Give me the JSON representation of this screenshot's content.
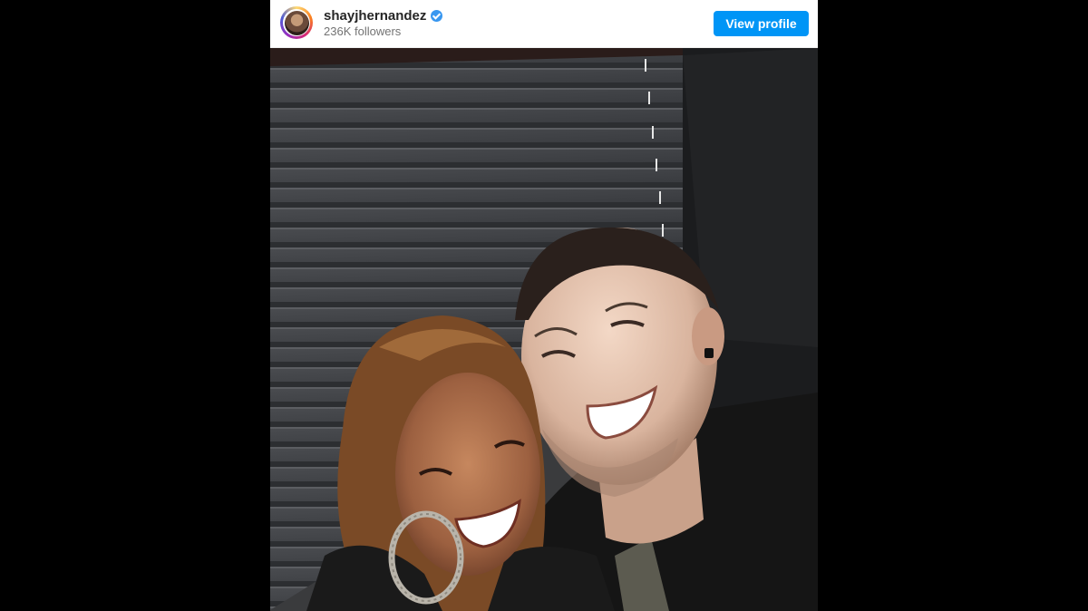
{
  "post": {
    "username": "shayjhernandez",
    "followers": "236K followers",
    "view_profile_label": "View profile",
    "verified": true
  },
  "icons": {
    "verified": "verified-badge-icon",
    "avatar": "profile-avatar"
  },
  "colors": {
    "accent": "#0095f6",
    "verified": "#3897f0",
    "username": "#262626",
    "secondary_text": "#737373",
    "page_background": "#000000"
  }
}
